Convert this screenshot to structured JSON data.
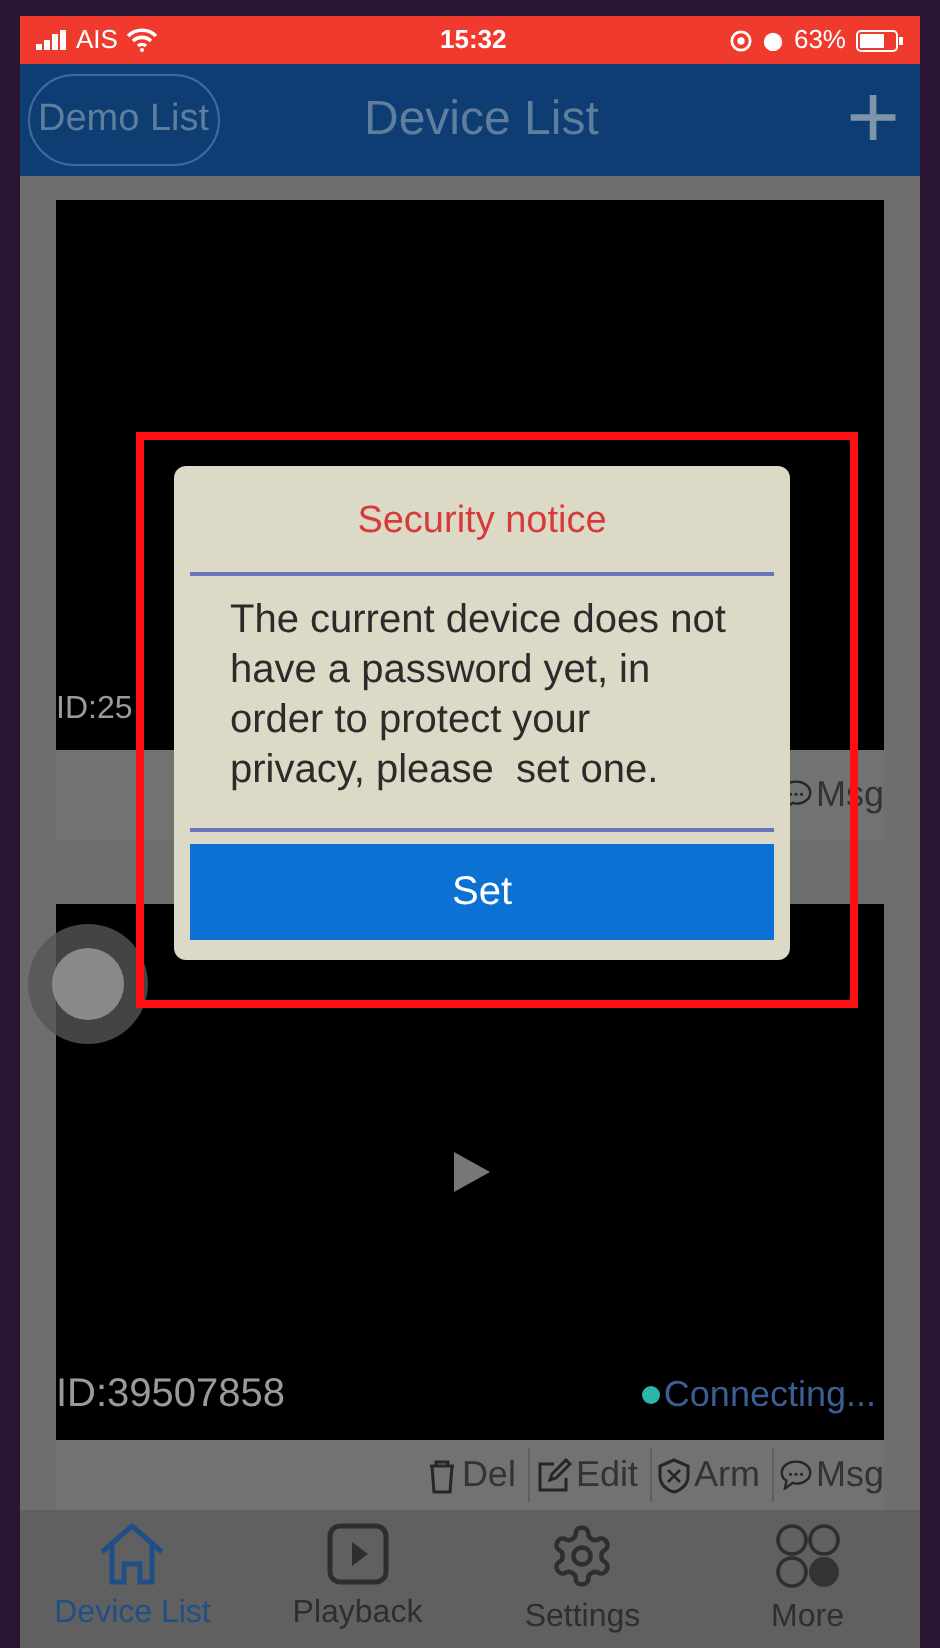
{
  "status_bar": {
    "carrier": "AIS",
    "time": "15:32",
    "battery": "63%"
  },
  "nav": {
    "left_button": "Demo List",
    "title": "Device List",
    "add_button": "+"
  },
  "devices": [
    {
      "id": "ID:25",
      "actions": [
        {
          "kind": "message",
          "label": "Msg"
        }
      ]
    },
    {
      "id": "ID:39507858",
      "status": "Connecting...",
      "color": "#2fb5a5",
      "actions": [
        {
          "kind": "delete",
          "label": "Del"
        },
        {
          "kind": "edit",
          "label": "Edit"
        },
        {
          "kind": "arm",
          "label": "Arm"
        },
        {
          "kind": "message",
          "label": "Msg"
        }
      ]
    }
  ],
  "dialog": {
    "title": "Security notice",
    "message": "The current device does not have a password yet, in order to protect your privacy, please  set one.",
    "button": "Set"
  },
  "tabs": [
    {
      "kind": "home",
      "label": "Device List",
      "selected": true
    },
    {
      "kind": "playback",
      "label": "Playback",
      "selected": false
    },
    {
      "kind": "settings",
      "label": "Settings",
      "selected": false
    },
    {
      "kind": "more",
      "label": "More",
      "selected": false
    }
  ]
}
